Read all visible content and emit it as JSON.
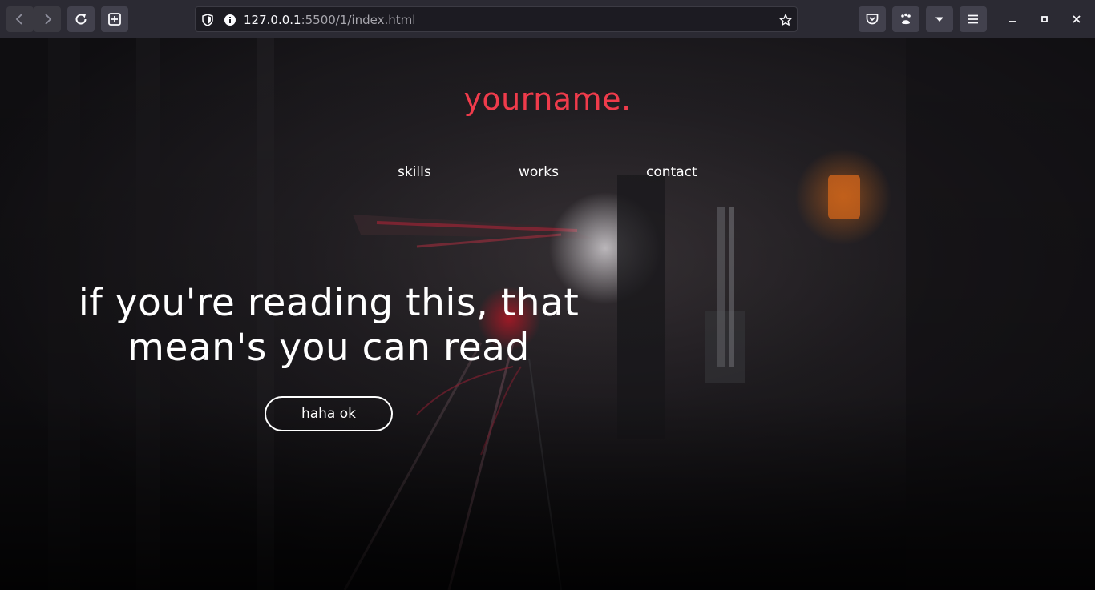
{
  "browser": {
    "url_host": "127.0.0.1",
    "url_rest": ":5500/1/index.html"
  },
  "icons": {
    "back": "arrow-left-icon",
    "forward": "arrow-right-icon",
    "reload": "reload-icon",
    "new_tab": "plus-square-icon",
    "tracking": "shield-icon",
    "site_info": "info-icon",
    "bookmark": "star-icon",
    "pocket": "pocket-icon",
    "extension": "paw-icon",
    "downloads": "caret-down-icon",
    "menu": "hamburger-icon",
    "minimize": "minimize-icon",
    "maximize": "maximize-icon",
    "close": "close-icon"
  },
  "page": {
    "brand": "yourname.",
    "nav": [
      "skills",
      "works",
      "contact"
    ],
    "headline_line1": "if you're reading this, that",
    "headline_line2": "mean's you can read",
    "cta_label": "haha ok"
  },
  "colors": {
    "brand": "#ef3b4b",
    "text": "#ffffff",
    "chrome_bg": "#2b2a33",
    "urlbar_bg": "#1c1b22"
  }
}
